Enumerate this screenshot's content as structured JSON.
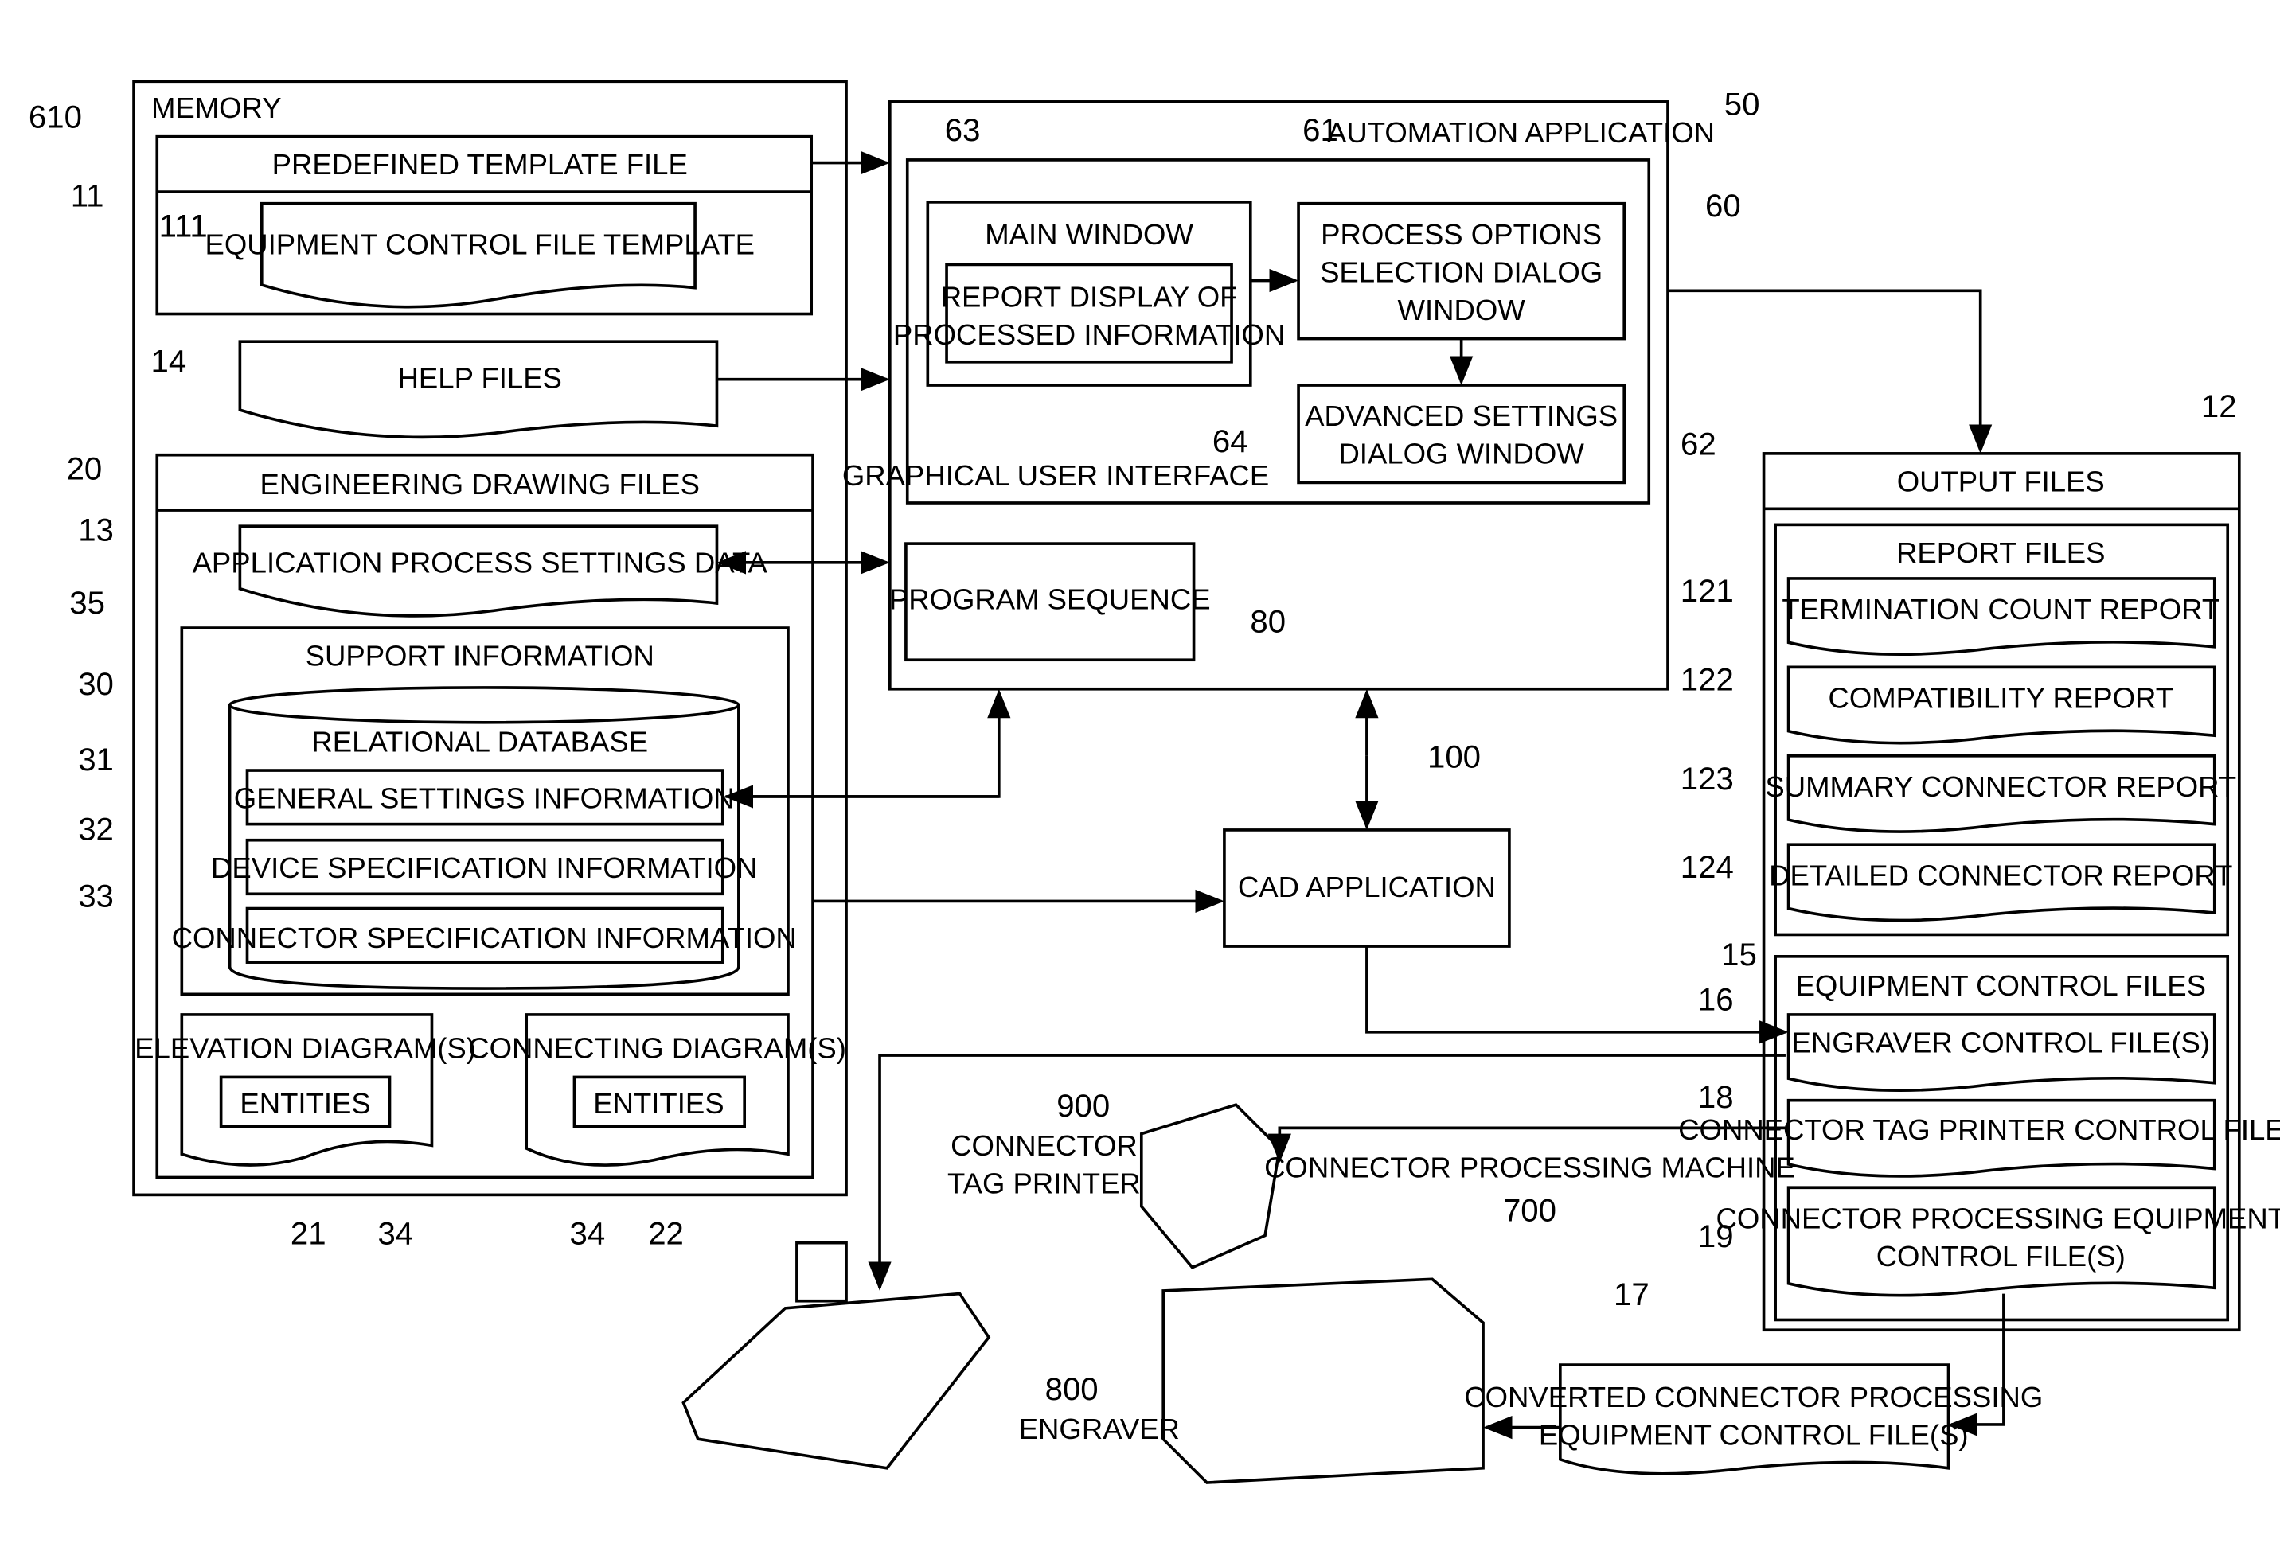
{
  "memory": {
    "ref": "610",
    "label": "MEMORY",
    "predefined_template": {
      "ref": "11",
      "label": "PREDEFINED TEMPLATE FILE",
      "equipment_template": {
        "ref": "111",
        "label": "EQUIPMENT CONTROL FILE TEMPLATE"
      }
    },
    "help_files": {
      "ref": "14",
      "label": "HELP FILES"
    },
    "engineering": {
      "ref": "20",
      "label": "ENGINEERING DRAWING FILES",
      "app_settings": {
        "ref": "13",
        "label": "APPLICATION PROCESS SETTINGS DATA"
      },
      "support": {
        "ref": "35",
        "label": "SUPPORT INFORMATION",
        "db": {
          "ref": "30",
          "label": "RELATIONAL DATABASE",
          "items": [
            {
              "ref": "31",
              "label": "GENERAL SETTINGS INFORMATION"
            },
            {
              "ref": "32",
              "label": "DEVICE SPECIFICATION INFORMATION"
            },
            {
              "ref": "33",
              "label": "CONNECTOR SPECIFICATION INFORMATION"
            }
          ]
        }
      },
      "elevation": {
        "ref": "21",
        "label": "ELEVATION DIAGRAM(S)",
        "entities": "ENTITIES",
        "entities_ref": "34"
      },
      "connecting": {
        "ref": "22",
        "label": "CONNECTING DIAGRAM(S)",
        "entities": "ENTITIES",
        "entities_ref": "34"
      }
    }
  },
  "automation": {
    "ref": "50",
    "label": "AUTOMATION APPLICATION",
    "gui": {
      "ref": "60",
      "label": "GRAPHICAL USER INTERFACE",
      "main_window": {
        "ref": "63",
        "label": "MAIN WINDOW",
        "report_display": {
          "ref": "64",
          "label1": "REPORT DISPLAY OF",
          "label2": "PROCESSED INFORMATION"
        }
      },
      "process_options": {
        "ref": "61",
        "label1": "PROCESS OPTIONS",
        "label2": "SELECTION DIALOG",
        "label3": "WINDOW"
      },
      "advanced": {
        "ref": "62",
        "label1": "ADVANCED SETTINGS",
        "label2": "DIALOG WINDOW"
      }
    },
    "program_sequence": {
      "ref": "80",
      "label": "PROGRAM SEQUENCE"
    }
  },
  "cad": {
    "ref": "100",
    "label": "CAD APPLICATION"
  },
  "output": {
    "label": "OUTPUT FILES",
    "reports": {
      "ref": "12",
      "label": "REPORT FILES",
      "items": [
        {
          "ref": "121",
          "label": "TERMINATION COUNT REPORT"
        },
        {
          "ref": "122",
          "label": "COMPATIBILITY REPORT"
        },
        {
          "ref": "123",
          "label": "SUMMARY CONNECTOR REPORT"
        },
        {
          "ref": "124",
          "label": "DETAILED CONNECTOR REPORT"
        }
      ]
    },
    "equipment": {
      "ref": "15",
      "label": "EQUIPMENT CONTROL FILES",
      "items": [
        {
          "ref": "16",
          "label": "ENGRAVER CONTROL FILE(S)"
        },
        {
          "ref": "18",
          "label": "CONNECTOR TAG PRINTER CONTROL FILE(S)"
        },
        {
          "ref": "19",
          "label1": "CONNECTOR PROCESSING EQUIPMENT",
          "label2": "CONTROL FILE(S)"
        }
      ]
    }
  },
  "converted": {
    "ref": "17",
    "label1": "CONVERTED CONNECTOR PROCESSING",
    "label2": "EQUIPMENT CONTROL FILE(S)"
  },
  "printer": {
    "ref": "900",
    "label1": "CONNECTOR",
    "label2": "TAG PRINTER"
  },
  "machine": {
    "ref": "700",
    "label": "CONNECTOR PROCESSING MACHINE"
  },
  "engraver": {
    "ref": "800",
    "label": "ENGRAVER"
  }
}
